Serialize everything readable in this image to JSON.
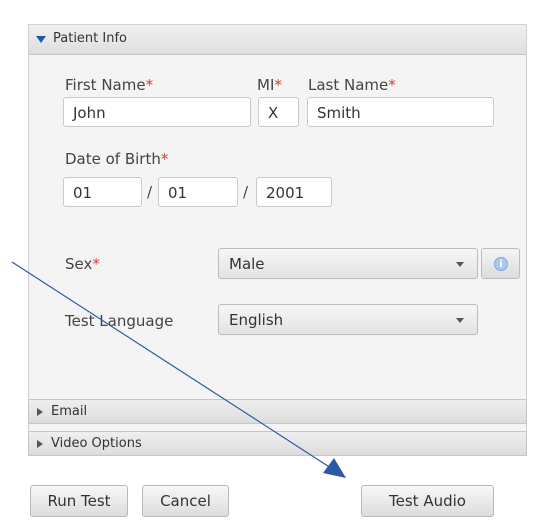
{
  "patient_info": {
    "header": "Patient Info",
    "first_name": {
      "label": "First Name",
      "required_mark": "*",
      "value": "John"
    },
    "mi": {
      "label": "MI",
      "required_mark": "*",
      "value": "X"
    },
    "last_name": {
      "label": "Last Name",
      "required_mark": "*",
      "value": "Smith"
    },
    "dob": {
      "label": "Date of Birth",
      "required_mark": "*",
      "month": "01",
      "day": "01",
      "year": "2001",
      "separator": "/"
    },
    "sex": {
      "label": "Sex",
      "required_mark": "*",
      "value": "Male"
    },
    "test_language": {
      "label": "Test Language",
      "value": "English"
    }
  },
  "sections": {
    "email": "Email",
    "video_options": "Video Options"
  },
  "buttons": {
    "run_test": "Run Test",
    "cancel": "Cancel",
    "test_audio": "Test Audio"
  },
  "icons": {
    "info": "info-icon"
  },
  "colors": {
    "required": "#d33b3b",
    "arrow": "#2b5aa8",
    "info": "#a9c9ee"
  }
}
